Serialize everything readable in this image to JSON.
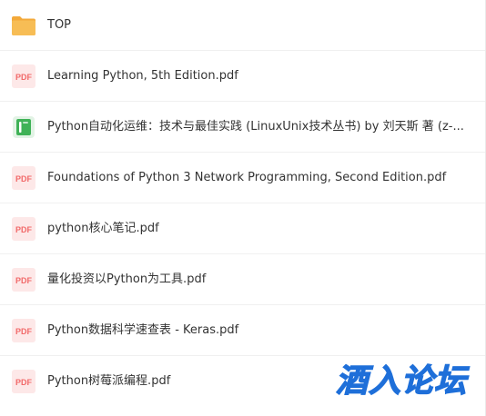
{
  "files": [
    {
      "name": "TOP",
      "type": "folder",
      "icon": "folder-icon"
    },
    {
      "name": "Learning Python, 5th Edition.pdf",
      "type": "pdf",
      "icon": "pdf-file-icon"
    },
    {
      "name": "Python自动化运维：技术与最佳实践 (LinuxUnix技术丛书) by 刘天斯 著 (z-...",
      "type": "epub",
      "icon": "ebook-file-icon"
    },
    {
      "name": "Foundations of Python 3 Network Programming, Second Edition.pdf",
      "type": "pdf",
      "icon": "pdf-file-icon"
    },
    {
      "name": "python核心笔记.pdf",
      "type": "pdf",
      "icon": "pdf-file-icon"
    },
    {
      "name": "量化投资以Python为工具.pdf",
      "type": "pdf",
      "icon": "pdf-file-icon"
    },
    {
      "name": "Python数据科学速查表 - Keras.pdf",
      "type": "pdf",
      "icon": "pdf-file-icon"
    },
    {
      "name": "Python树莓派编程.pdf",
      "type": "pdf",
      "icon": "pdf-file-icon"
    }
  ],
  "icon_labels": {
    "pdf": "PDF"
  },
  "watermark": {
    "text": "酒入论坛",
    "color": "#1e6fd9"
  },
  "colors": {
    "folder": "#f5b94d",
    "folder_tab": "#f3a93a",
    "pdf_bg": "#fde8e8",
    "pdf_text": "#f26a6a",
    "ebook_bg": "#3fb257",
    "ebook_mark": "#ffffff",
    "text": "#333333"
  }
}
